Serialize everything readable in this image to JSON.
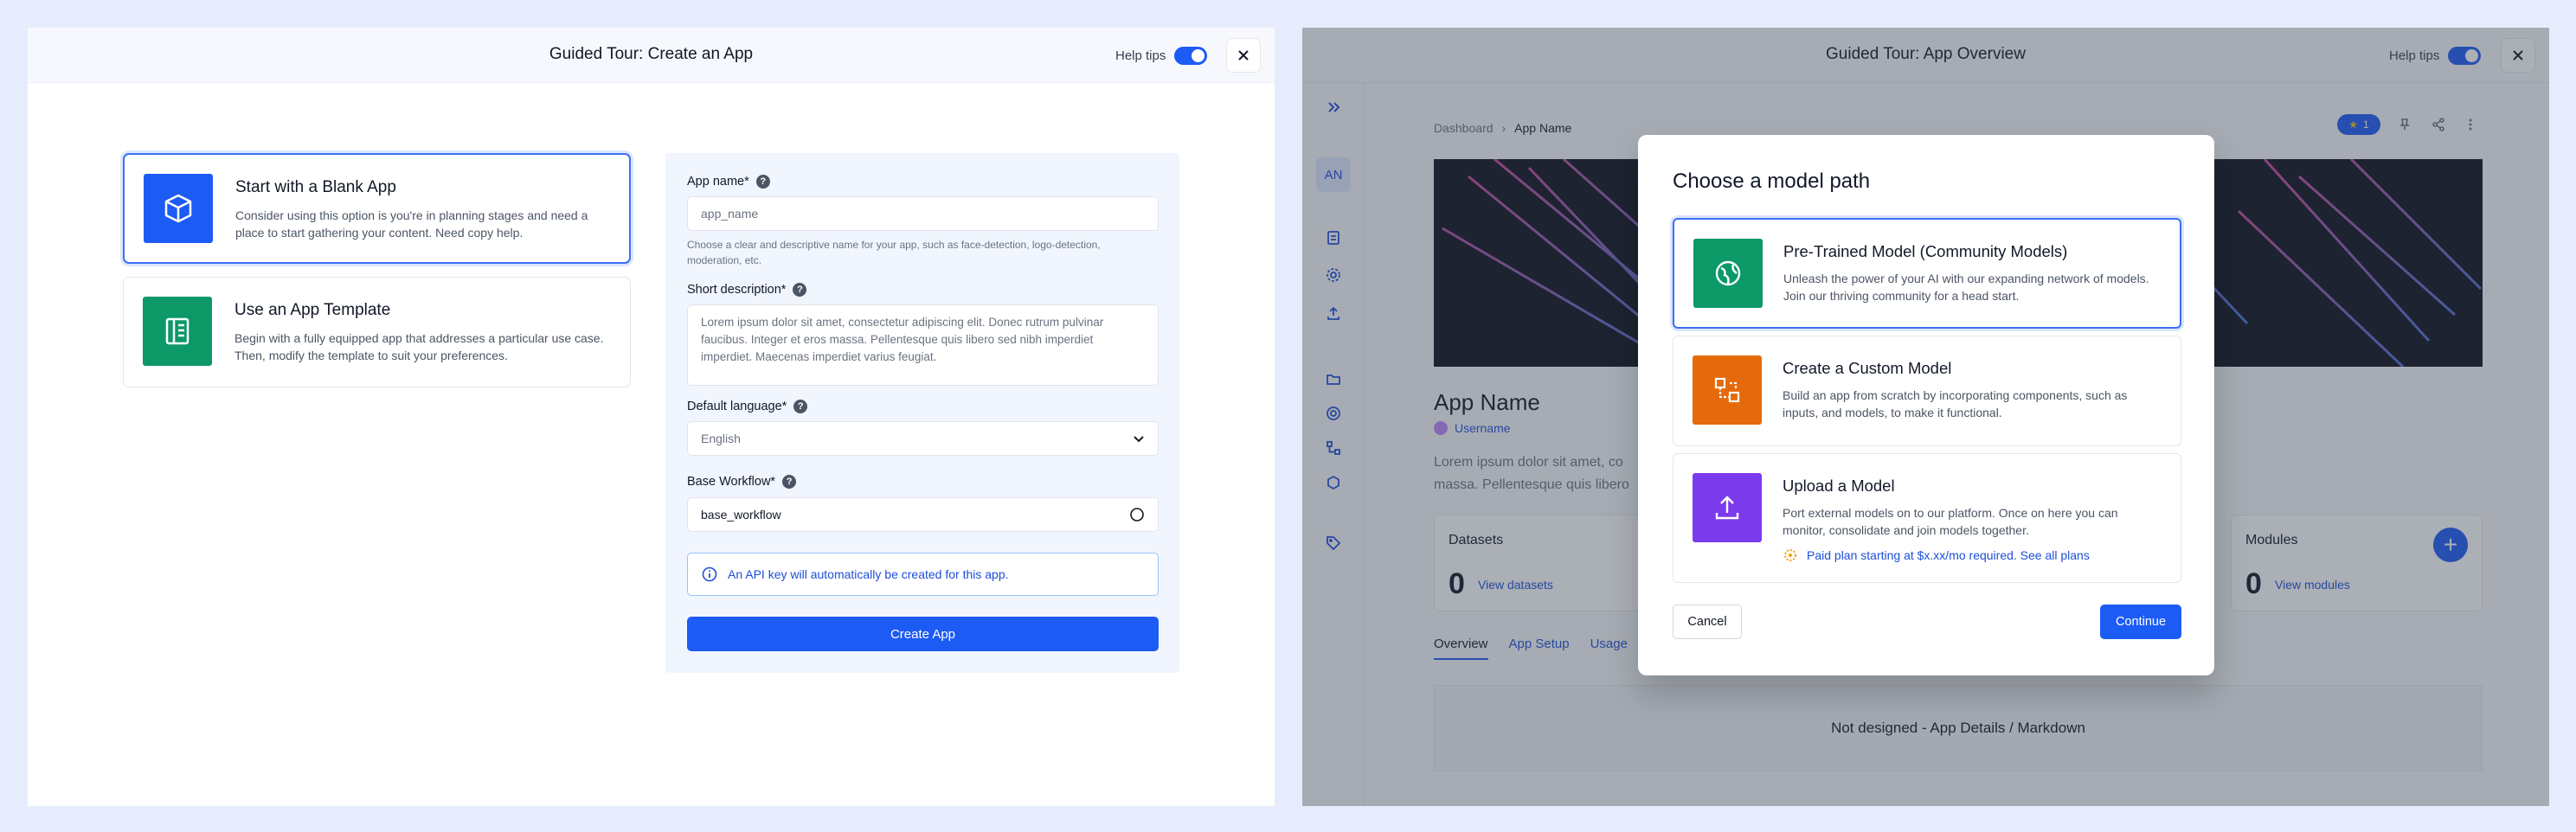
{
  "left": {
    "header": {
      "title": "Guided Tour: Create an App",
      "help_tips_label": "Help tips"
    },
    "options": [
      {
        "title": "Start with a Blank App",
        "description": "Consider using this option is you're in planning stages and need a place to start gathering your content. Need copy help."
      },
      {
        "title": "Use an App Template",
        "description": "Begin with a fully equipped app that addresses a particular use case. Then, modify the template to suit your preferences."
      }
    ],
    "form": {
      "app_name_label": "App name*",
      "app_name_value": "app_name",
      "app_name_help": "Choose a clear and descriptive name for your app, such as face-detection, logo-detection, moderation, etc.",
      "short_desc_label": "Short description*",
      "short_desc_value": "Lorem ipsum dolor sit amet, consectetur adipiscing elit. Donec rutrum pulvinar faucibus. Integer et eros massa. Pellentesque quis libero sed nibh imperdiet imperdiet. Maecenas imperdiet varius feugiat.",
      "language_label": "Default language*",
      "language_value": "English",
      "workflow_label": "Base Workflow*",
      "workflow_value": "base_workflow",
      "info_text": "An API key will automatically be created for this app.",
      "submit_label": "Create App"
    }
  },
  "right": {
    "header": {
      "title": "Guided Tour: App Overview",
      "help_tips_label": "Help tips"
    },
    "sidebar": {
      "avatar_initials": "AN"
    },
    "breadcrumb": {
      "root": "Dashboard",
      "current": "App Name"
    },
    "star_count": "1",
    "app": {
      "name": "App Name",
      "username": "Username",
      "description_line1": "Lorem ipsum dolor sit amet, co",
      "description_line2": "massa. Pellentesque quis libero"
    },
    "stats": {
      "datasets_title": "Datasets",
      "datasets_count": "0",
      "datasets_link": "View datasets",
      "modules_title": "Modules",
      "modules_count": "0",
      "modules_link": "View modules"
    },
    "tabs": [
      "Overview",
      "App Setup",
      "Usage"
    ],
    "markdown_placeholder": "Not designed - App Details / Markdown",
    "modal": {
      "title": "Choose a model path",
      "cards": [
        {
          "title": "Pre-Trained Model (Community Models)",
          "description": "Unleash the power of your AI with our expanding network of models. Join our thriving community for a head start."
        },
        {
          "title": "Create a Custom Model",
          "description": "Build an app from scratch by incorporating components, such as inputs, and models, to make it functional."
        },
        {
          "title": "Upload a Model",
          "description": "Port external models on to our platform. Once on here you can monitor, consolidate and join models together.",
          "plan_note": "Paid plan starting at $x.xx/mo required. See all plans"
        }
      ],
      "cancel_label": "Cancel",
      "continue_label": "Continue"
    }
  },
  "colors": {
    "primary": "#1d5bf5",
    "green": "#0d9868",
    "orange": "#e56a0b",
    "purple": "#7c3aed"
  }
}
